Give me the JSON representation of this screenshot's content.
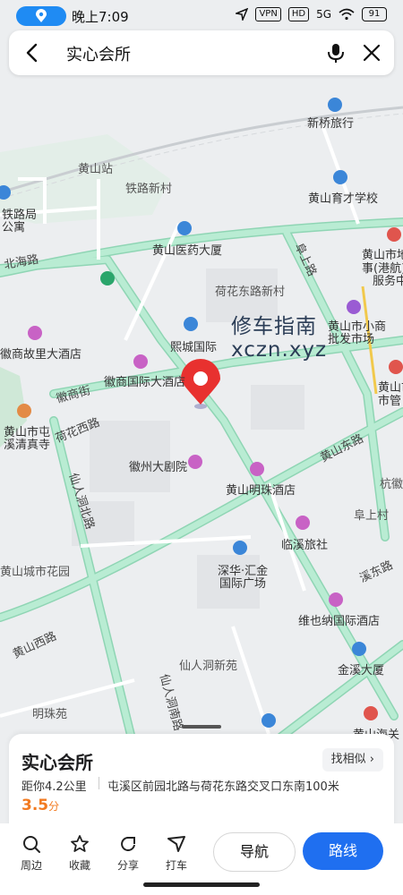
{
  "status": {
    "time": "晚上7:09",
    "vpn": "VPN",
    "hd": "HD",
    "network": "5G",
    "battery": "91"
  },
  "search": {
    "query": "实心会所"
  },
  "map": {
    "places": [
      {
        "name": "新桥旅行",
        "kind": "poi"
      },
      {
        "name": "黄山站",
        "kind": "station"
      },
      {
        "name": "铁路新村",
        "kind": "area"
      },
      {
        "name": "黄山育才学校",
        "kind": "poi"
      },
      {
        "name": "铁路局",
        "kind": "poi"
      },
      {
        "name": "公寓",
        "kind": "poi"
      },
      {
        "name": "黄山医药大厦",
        "kind": "poi"
      },
      {
        "name": "北海路",
        "kind": "road"
      },
      {
        "name": "阜上路",
        "kind": "road"
      },
      {
        "name": "黄山市地",
        "kind": "poi"
      },
      {
        "name": "事(港航)",
        "kind": "poi"
      },
      {
        "name": "服务中",
        "kind": "poi"
      },
      {
        "name": "荷花东路新村",
        "kind": "area"
      },
      {
        "name": "黄山市小商",
        "kind": "poi"
      },
      {
        "name": "批发市场",
        "kind": "poi"
      },
      {
        "name": "熙城国际",
        "kind": "poi"
      },
      {
        "name": "徽商故里大酒店",
        "kind": "poi"
      },
      {
        "name": "徽商国际大酒店",
        "kind": "poi"
      },
      {
        "name": "徽商街",
        "kind": "road"
      },
      {
        "name": "黄山市",
        "kind": "poi"
      },
      {
        "name": "市管",
        "kind": "poi"
      },
      {
        "name": "黄山市屯",
        "kind": "poi"
      },
      {
        "name": "溪清真寺",
        "kind": "poi"
      },
      {
        "name": "荷花西路",
        "kind": "road"
      },
      {
        "name": "徽州大剧院",
        "kind": "poi"
      },
      {
        "name": "黄山明珠酒店",
        "kind": "poi"
      },
      {
        "name": "黄山东路",
        "kind": "road"
      },
      {
        "name": "杭徽",
        "kind": "road"
      },
      {
        "name": "仙人洞北路",
        "kind": "road"
      },
      {
        "name": "阜上村",
        "kind": "area"
      },
      {
        "name": "临溪旅社",
        "kind": "poi"
      },
      {
        "name": "黄山城市花园",
        "kind": "area"
      },
      {
        "name": "深华·汇金",
        "kind": "poi"
      },
      {
        "name": "国际广场",
        "kind": "poi"
      },
      {
        "name": "溪东路",
        "kind": "road"
      },
      {
        "name": "维也纳国际酒店",
        "kind": "poi"
      },
      {
        "name": "黄山西路",
        "kind": "road"
      },
      {
        "name": "仙人洞新苑",
        "kind": "area"
      },
      {
        "name": "金溪大厦",
        "kind": "poi"
      },
      {
        "name": "仙人洞南路",
        "kind": "road"
      },
      {
        "name": "明珠苑",
        "kind": "area"
      },
      {
        "name": "黄山海关",
        "kind": "poi"
      }
    ]
  },
  "watermark": {
    "line1": "修车指南",
    "line2": "xczn.xyz"
  },
  "place_card": {
    "name": "实心会所",
    "find_similar": "找相似",
    "distance": "距你4.2公里",
    "address": "屯溪区前园北路与荷花东路交叉口东南100米",
    "rating": "3.5",
    "rating_unit": "分"
  },
  "toolbar": {
    "nearby": "周边",
    "favorite": "收藏",
    "share": "分享",
    "taxi": "打车",
    "navigate": "导航",
    "route": "路线"
  },
  "colors": {
    "road": "#a7e3c6",
    "road_edge": "#8fd5b4",
    "pin": "#e8312f",
    "primary": "#1f6ff0",
    "rating": "#f27a20"
  }
}
